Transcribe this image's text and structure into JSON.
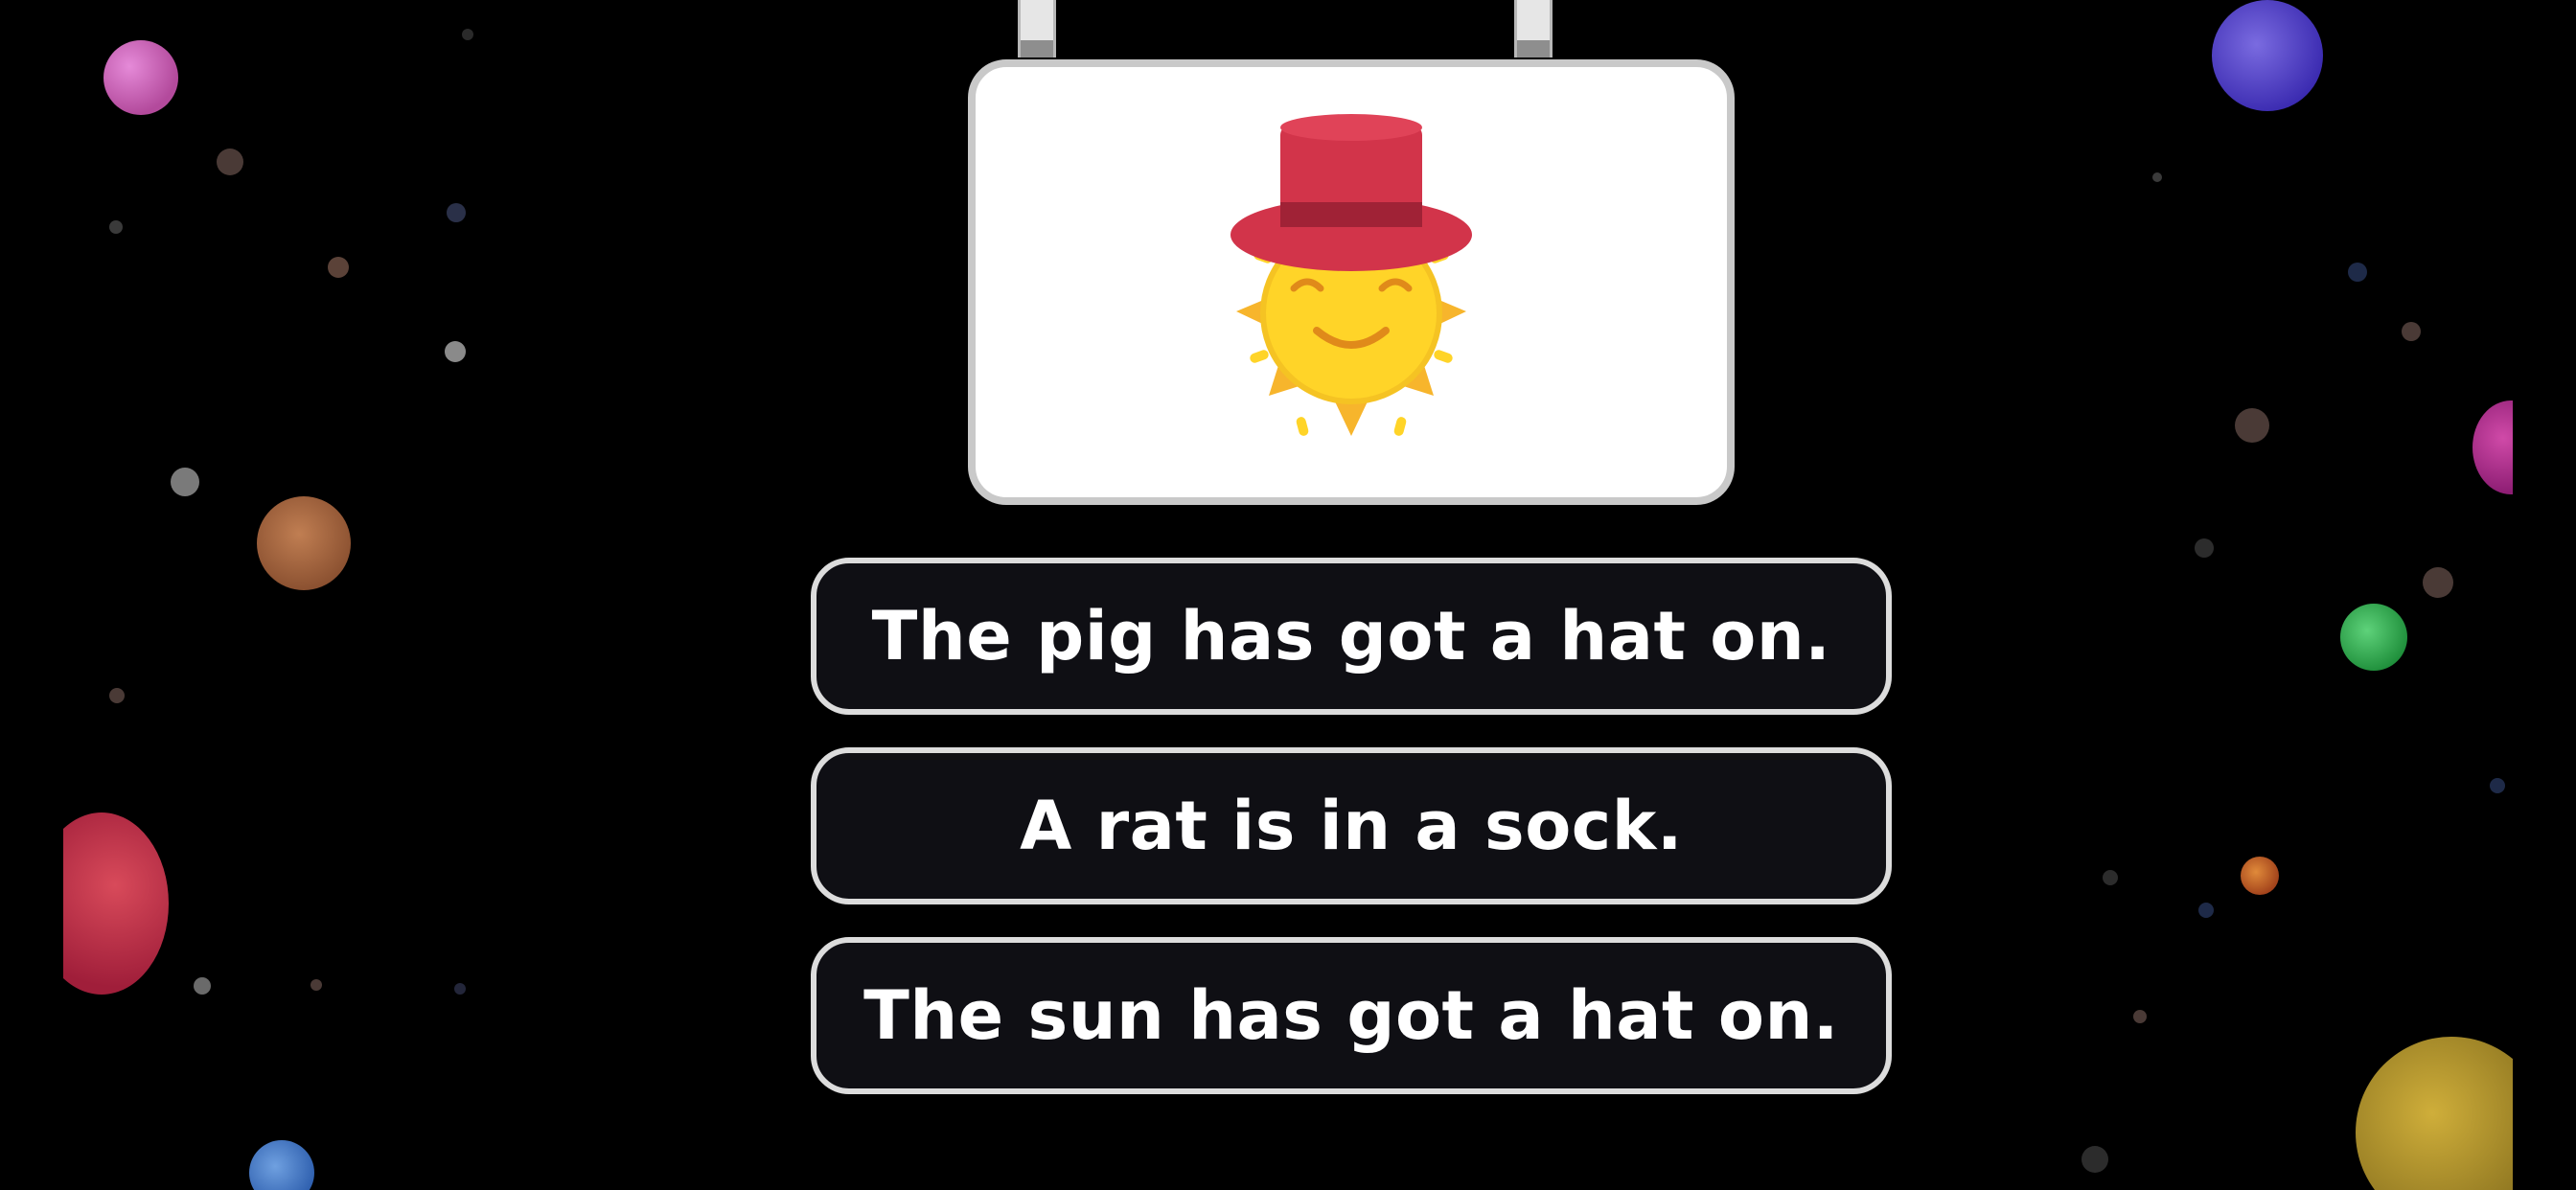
{
  "game": {
    "prompt_image": {
      "icon": "sun-with-top-hat-icon",
      "description_visible": false
    },
    "answer_options": [
      {
        "label": "The pig has got a hat on."
      },
      {
        "label": "A rat is in a sock."
      },
      {
        "label": "The sun has got a hat on."
      }
    ]
  },
  "colors": {
    "background": "#000000",
    "card_border": "#c9c9c9",
    "option_fill": "#0f0f14",
    "option_border": "#dcdcdc",
    "option_text": "#ffffff",
    "hat": "#d2344a",
    "sun": "#ffd428"
  }
}
